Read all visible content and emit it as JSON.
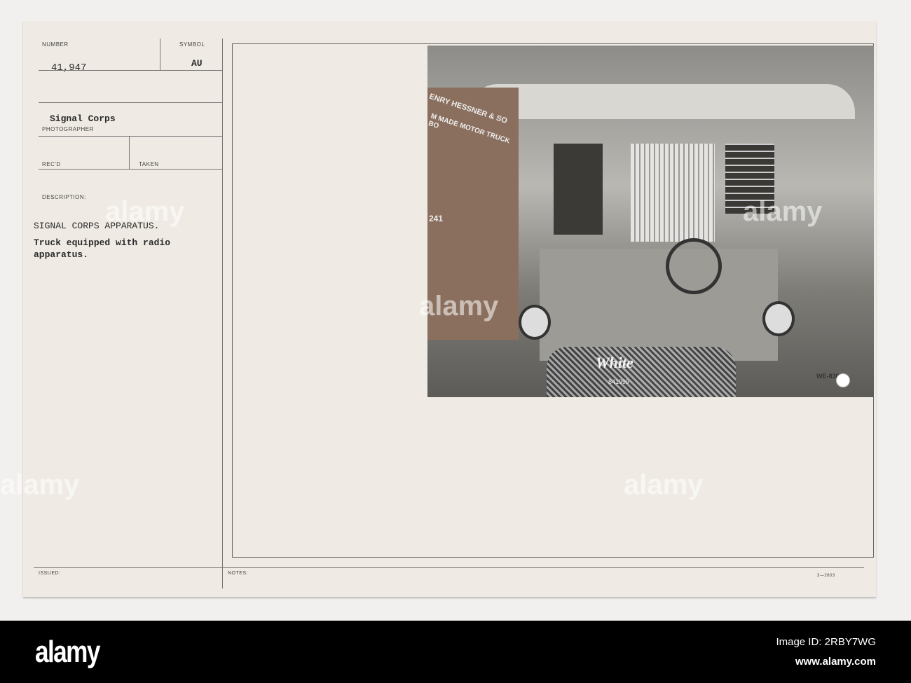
{
  "card": {
    "number_label": "NUMBER",
    "number": "41,947",
    "symbol_label": "SYMBOL",
    "symbol": "AU",
    "photographer": "Signal Corps",
    "photographer_label": "PHOTOGRAPHER",
    "recd_label": "REC'D",
    "taken_label": "TAKEN",
    "description_label": "DESCRIPTION:",
    "description_title": "SIGNAL CORPS APPARATUS.",
    "description_line1": "Truck equipped with radio",
    "description_line2": "apparatus.",
    "issued_label": "ISSUED:",
    "notes_label": "NOTES:",
    "form_number": "3—2603"
  },
  "photo": {
    "sign_text": "ENRY HESSNER & SO",
    "sign_text2": "M MADE MOTOR TRUCK BO",
    "plate": "WE-8360",
    "radiator_brand": "White",
    "radiator_number": "841999",
    "side_number": "241"
  },
  "watermark": "alamy",
  "footer": {
    "logo": "alamy",
    "image_id": "Image ID: 2RBY7WG",
    "url": "www.alamy.com"
  }
}
